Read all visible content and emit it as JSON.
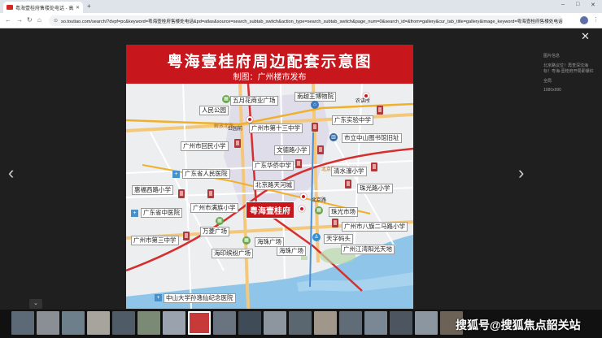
{
  "browser": {
    "tab_title": "粤海壹桂府售楼处电话 - 高...",
    "url": "so.toutiao.com/search/?dvpf=pc&keyword=粤海壹桂府售楼处电话&pd=atlas&source=search_subtab_switch&action_type=search_subtab_switch&page_num=0&search_id=&from=gallery&cur_tab_title=gallery&image_keyword=粤海壹桂府售楼处电话&image=..."
  },
  "viewer": {
    "info_title": "图片信息",
    "info_source": "北京路议位！再查深沈海标！粤海-壹桂府开局即爆红",
    "info_full": "全局",
    "info_size": "1080x990",
    "watermark": "搜狐号@搜狐焦点韶关站"
  },
  "map": {
    "title": "粤海壹桂府周边配套示意图",
    "subtitle": "制图：广州楼市发布",
    "main_label": "粤海壹桂府",
    "pois": [
      {
        "id": "wuyuehua",
        "label": "五月花商业广场"
      },
      {
        "id": "nanyue",
        "label": "南越王博物院"
      },
      {
        "id": "renmin-park",
        "label": "人民公园"
      },
      {
        "id": "gongyuanqian",
        "label": "公园前"
      },
      {
        "id": "no13",
        "label": "广州市第十三中学"
      },
      {
        "id": "shiyan",
        "label": "广东实验中学"
      },
      {
        "id": "nonglin",
        "label": "农讲所"
      },
      {
        "id": "huimin",
        "label": "广州市回民小学"
      },
      {
        "id": "wende",
        "label": "文德路小学"
      },
      {
        "id": "library",
        "label": "市立中山图书馆旧址"
      },
      {
        "id": "huaqiao",
        "label": "广东华侨中学"
      },
      {
        "id": "qingshui",
        "label": "清水濠小学"
      },
      {
        "id": "renmin-hosp",
        "label": "广东省人民医院"
      },
      {
        "id": "tianhe",
        "label": "北京路天河城"
      },
      {
        "id": "zhuguang",
        "label": "珠光路小学"
      },
      {
        "id": "huifu",
        "label": "惠福西路小学"
      },
      {
        "id": "manzu",
        "label": "广州市满族小学"
      },
      {
        "id": "beijinglu",
        "label": "北京路"
      },
      {
        "id": "zhongyi",
        "label": "广东省中医院"
      },
      {
        "id": "zhuguang-market",
        "label": "珠光市场"
      },
      {
        "id": "baqi",
        "label": "广州市八旗二马路小学"
      },
      {
        "id": "wanling",
        "label": "万菱广场"
      },
      {
        "id": "no3",
        "label": "广州市第三中学"
      },
      {
        "id": "tianzi",
        "label": "天字码头"
      },
      {
        "id": "haizhu-sq",
        "label": "海珠广场"
      },
      {
        "id": "jiangwan",
        "label": "广州江湾阳光天地"
      },
      {
        "id": "haiyin",
        "label": "海印缤纷广场"
      },
      {
        "id": "haizhu-gc",
        "label": "海珠广场"
      },
      {
        "id": "sunyatsen",
        "label": "中山大学孙逸仙纪念医院"
      }
    ],
    "roads": [
      "解放北路",
      "东风中路",
      "中山路",
      "文明路",
      "北京路",
      "越秀南路"
    ],
    "colors": {
      "banner": "#c8161d",
      "water": "#8ec5e8",
      "metro_red": "#d62e2e",
      "metro_yellow": "#f0b02a"
    }
  }
}
